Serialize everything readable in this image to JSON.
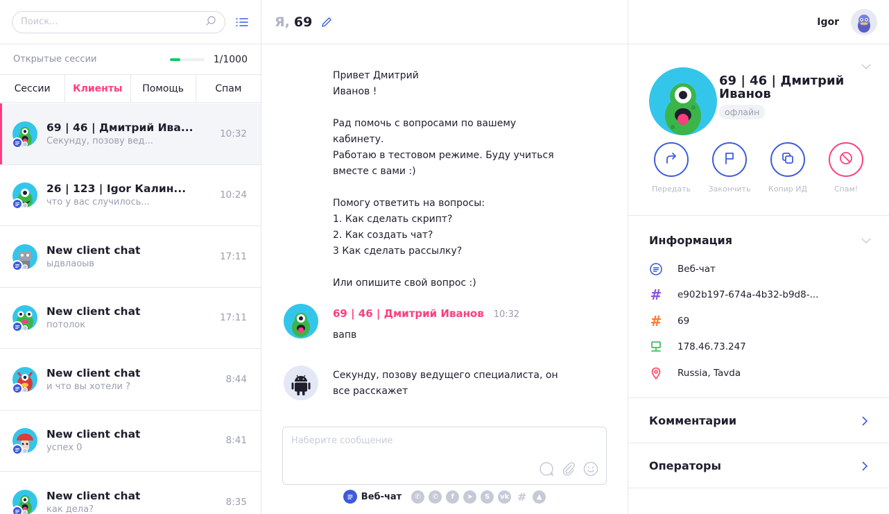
{
  "search": {
    "placeholder": "Поиск..."
  },
  "sessions": {
    "label": "Открытые сессии",
    "count": "1/1000",
    "progress_fraction": 0.3
  },
  "tabs": [
    {
      "label": "Сессии",
      "active": false
    },
    {
      "label": "Клиенты",
      "active": true
    },
    {
      "label": "Помощь",
      "active": false
    },
    {
      "label": "Спам",
      "active": false
    }
  ],
  "chats": [
    {
      "name": "69 | 46 | Дмитрий Ива...",
      "preview": "Секунду, позову вед...",
      "time": "10:32",
      "active": true,
      "avatar": "green-cyclops"
    },
    {
      "name": "26 | 123 | Igor Калин...",
      "preview": "что у вас случилось...",
      "time": "10:24",
      "active": false,
      "avatar": "green-alien"
    },
    {
      "name": "New client chat",
      "preview": "ыдвлаоыв",
      "time": "17:11",
      "active": false,
      "avatar": "gray-robot"
    },
    {
      "name": "New client chat",
      "preview": "потолок",
      "time": "17:11",
      "active": false,
      "avatar": "green-frog"
    },
    {
      "name": "New client chat",
      "preview": "и что вы хотели ?",
      "time": "8:44",
      "active": false,
      "avatar": "red-monster"
    },
    {
      "name": "New client chat",
      "preview": "успех 0",
      "time": "8:41",
      "active": false,
      "avatar": "red-mushroom"
    },
    {
      "name": "New client chat",
      "preview": "как дела?",
      "time": "8:35",
      "active": false,
      "avatar": "green-cyclops"
    }
  ],
  "header": {
    "me": "Я,",
    "number": "69"
  },
  "bot_message": {
    "paragraphs": [
      "Привет Дмитрий\nИванов !",
      "Рад помочь с вопросами по вашему\nкабинету.\nРаботаю в тестовом режиме. Буду учиться\nвместе с вами :)",
      "Помогу ответить на вопросы:\n1. Как сделать скрипт?\n2. Как создать чат?\n3 Как сделать рассылку?",
      "Или опишите свой вопрос :)"
    ]
  },
  "client_message": {
    "author": "69 | 46 | Дмитрий Иванов",
    "time": "10:32",
    "text": "вапв"
  },
  "bot_reply": {
    "text": "Секунду, позову ведущего специалиста, он\nвсе расскажет"
  },
  "composer": {
    "placeholder": "Наберите сообщение"
  },
  "channels": {
    "active_label": "Веб-чат",
    "others": [
      "viber-icon",
      "whatsapp-icon",
      "facebook-icon",
      "telegram-icon",
      "skype-icon",
      "vk-icon",
      "slack-icon",
      "other-icon"
    ]
  },
  "user": {
    "name": "Igor"
  },
  "profile": {
    "name": "69 | 46 | Дмитрий Иванов",
    "status": "офлайн",
    "actions": [
      {
        "label": "Передать",
        "icon": "forward-icon"
      },
      {
        "label": "Закончить",
        "icon": "flag-icon"
      },
      {
        "label": "Копир ИД",
        "icon": "copy-icon"
      },
      {
        "label": "Спам!",
        "icon": "block-icon"
      }
    ]
  },
  "info": {
    "title": "Информация",
    "rows": [
      {
        "icon": "chat-icon",
        "value": "Веб-чат",
        "color": "#3c5bdc"
      },
      {
        "icon": "hash-icon",
        "value": "e902b197-674a-4b32-b9d8-...",
        "color": "#8a4fe8"
      },
      {
        "icon": "hash-icon",
        "value": "69",
        "color": "#ff7a2f"
      },
      {
        "icon": "monitor-icon",
        "value": "178.46.73.247",
        "color": "#2bb24c"
      },
      {
        "icon": "location-pin-icon",
        "value": "Russia, Tavda",
        "color": "#ff3d5a"
      }
    ]
  },
  "sections": {
    "comments": "Комментарии",
    "operators": "Операторы"
  },
  "colors": {
    "accent": "#3c5bdc",
    "pink": "#ff3d7f",
    "green": "#17c964"
  }
}
